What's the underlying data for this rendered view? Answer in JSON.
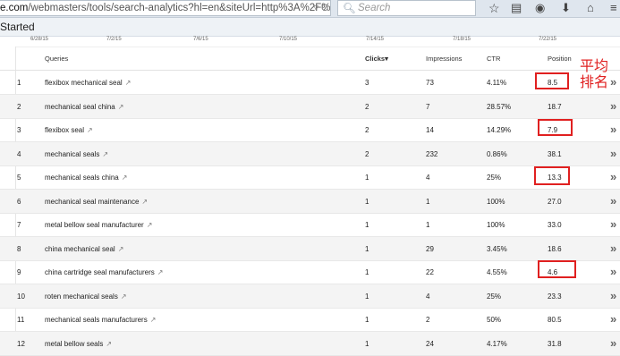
{
  "browser": {
    "url_domain": "e.com",
    "url_path": "/webmasters/tools/search-analytics?hl=en&siteUrl=http%3A%2F%",
    "url_controls": "▿ C",
    "search_placeholder": "Search",
    "icons": [
      "search-icon",
      "star-icon",
      "reading-list-icon",
      "pocket-icon",
      "download-icon",
      "home-icon"
    ]
  },
  "bookmarks": {
    "label": "Started"
  },
  "timeline": {
    "dates": [
      "6/28/15",
      "7/2/15",
      "7/6/15",
      "7/10/15",
      "7/14/15",
      "7/18/15",
      "7/22/15"
    ]
  },
  "table": {
    "headers": {
      "queries": "Queries",
      "clicks": "Clicks",
      "clicks_sort": "▾",
      "impressions": "Impressions",
      "ctr": "CTR",
      "position": "Position"
    },
    "rows": [
      {
        "n": "1",
        "query": "flexibox mechanical seal",
        "clicks": "3",
        "impressions": "73",
        "ctr": "4.11%",
        "position": "8.5"
      },
      {
        "n": "2",
        "query": "mechanical seal china",
        "clicks": "2",
        "impressions": "7",
        "ctr": "28.57%",
        "position": "18.7"
      },
      {
        "n": "3",
        "query": "flexibox seal",
        "clicks": "2",
        "impressions": "14",
        "ctr": "14.29%",
        "position": "7.9"
      },
      {
        "n": "4",
        "query": "mechanical seals",
        "clicks": "2",
        "impressions": "232",
        "ctr": "0.86%",
        "position": "38.1"
      },
      {
        "n": "5",
        "query": "mechanical seals china",
        "clicks": "1",
        "impressions": "4",
        "ctr": "25%",
        "position": "13.3"
      },
      {
        "n": "6",
        "query": "mechanical seal maintenance",
        "clicks": "1",
        "impressions": "1",
        "ctr": "100%",
        "position": "27.0"
      },
      {
        "n": "7",
        "query": "metal bellow seal manufacturer",
        "clicks": "1",
        "impressions": "1",
        "ctr": "100%",
        "position": "33.0"
      },
      {
        "n": "8",
        "query": "china mechanical seal",
        "clicks": "1",
        "impressions": "29",
        "ctr": "3.45%",
        "position": "18.6"
      },
      {
        "n": "9",
        "query": "china cartridge seal manufacturers",
        "clicks": "1",
        "impressions": "22",
        "ctr": "4.55%",
        "position": "4.6"
      },
      {
        "n": "10",
        "query": "roten mechanical seals",
        "clicks": "1",
        "impressions": "4",
        "ctr": "25%",
        "position": "23.3"
      },
      {
        "n": "11",
        "query": "mechanical seals manufacturers",
        "clicks": "1",
        "impressions": "2",
        "ctr": "50%",
        "position": "80.5"
      },
      {
        "n": "12",
        "query": "metal bellow seals",
        "clicks": "1",
        "impressions": "24",
        "ctr": "4.17%",
        "position": "31.8"
      }
    ],
    "row_chevron": "»",
    "external_link_glyph": "↗"
  },
  "annotation": {
    "text": "平均排名",
    "color": "#e02020",
    "highlighted_positions": [
      "8.5",
      "7.9",
      "13.3",
      "4.6"
    ]
  }
}
